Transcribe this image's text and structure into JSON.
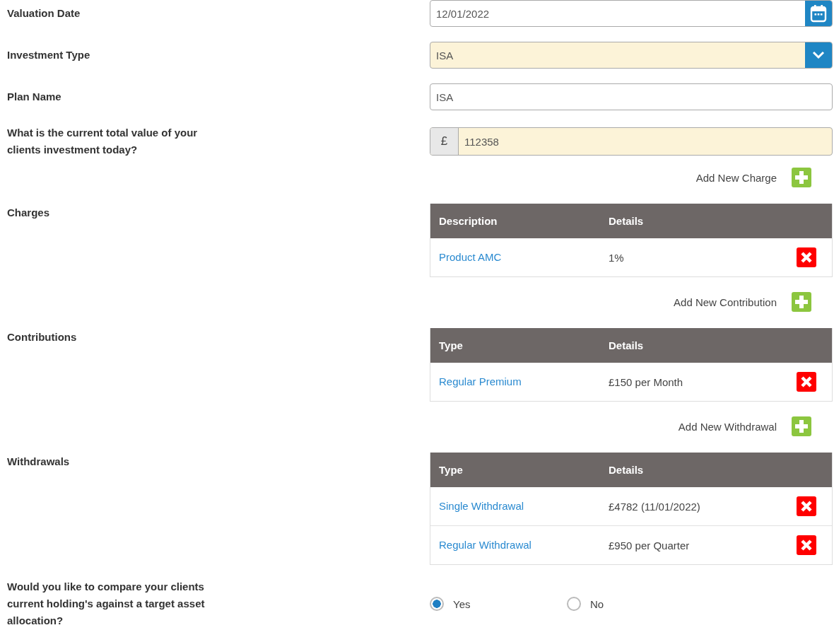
{
  "fields": [
    {
      "label": "Valuation Date",
      "kind": "date",
      "value": "12/01/2022",
      "highlighted": false
    },
    {
      "label": "Investment Type",
      "kind": "select",
      "value": "ISA",
      "highlighted": true
    },
    {
      "label": "Plan Name",
      "kind": "text",
      "value": "ISA",
      "highlighted": false
    },
    {
      "label": "What is the current total value of your clients investment today?",
      "kind": "currency",
      "prefix": "£",
      "value": "112358",
      "highlighted": true
    }
  ],
  "sections": [
    {
      "label": "Charges",
      "add_label": "Add New Charge",
      "columns": [
        "Description",
        "Details"
      ],
      "rows": [
        {
          "name": "Product AMC",
          "details": "1%"
        }
      ]
    },
    {
      "label": "Contributions",
      "add_label": "Add New Contribution",
      "columns": [
        "Type",
        "Details"
      ],
      "rows": [
        {
          "name": "Regular Premium",
          "details": "£150 per Month"
        }
      ]
    },
    {
      "label": "Withdrawals",
      "add_label": "Add New Withdrawal",
      "columns": [
        "Type",
        "Details"
      ],
      "rows": [
        {
          "name": "Single Withdrawal",
          "details": "£4782 (11/01/2022)"
        },
        {
          "name": "Regular Withdrawal",
          "details": "£950 per Quarter"
        }
      ]
    }
  ],
  "question": {
    "label": "Would you like to compare your clients current holding's against a target asset allocation?",
    "options": [
      {
        "label": "Yes",
        "selected": true
      },
      {
        "label": "No",
        "selected": false
      }
    ]
  }
}
